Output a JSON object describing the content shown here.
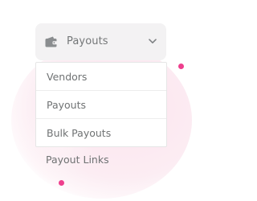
{
  "selector": {
    "label": "Payouts",
    "icon": "wallet-icon",
    "expand_icon": "chevron-down-icon"
  },
  "menu": {
    "items": [
      {
        "label": "Vendors"
      },
      {
        "label": "Payouts"
      },
      {
        "label": "Bulk Payouts"
      }
    ]
  },
  "extra_item": {
    "label": "Payout Links"
  },
  "colors": {
    "accent": "#ee3f8d",
    "blob": "#fbe4ee",
    "selector_bg": "#f3f2f3",
    "text": "#6f7273",
    "icon": "#8a8d8f"
  }
}
